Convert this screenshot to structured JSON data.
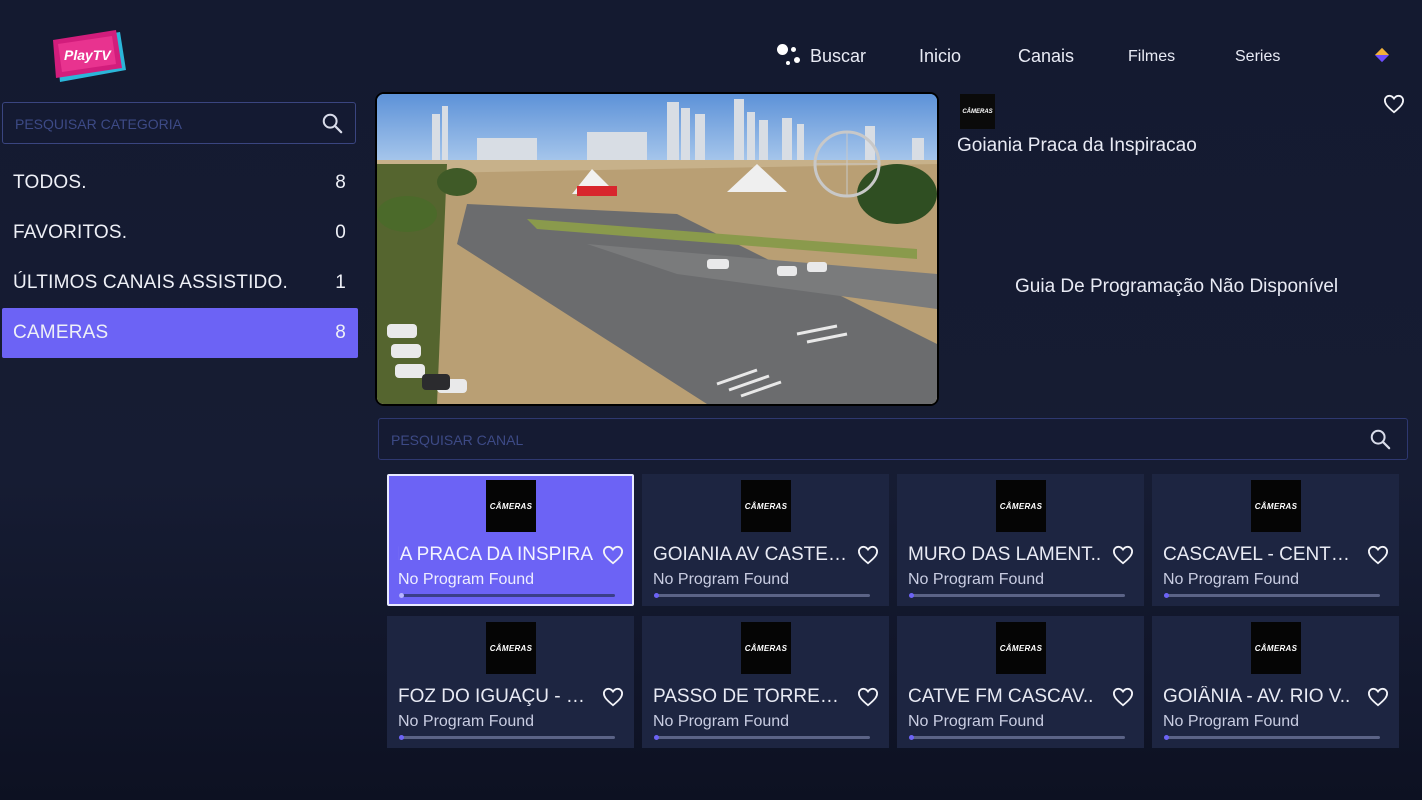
{
  "header": {
    "logo_text": "PlayTV",
    "nav": {
      "search": "Buscar",
      "home": "Inicio",
      "channels": "Canais",
      "movies": "Filmes",
      "series": "Series"
    }
  },
  "sidebar": {
    "search_placeholder": "PESQUISAR CATEGORIA",
    "categories": [
      {
        "label": "TODOS.",
        "count": "8",
        "active": false
      },
      {
        "label": "FAVORITOS.",
        "count": "0",
        "active": false
      },
      {
        "label": "ÚLTIMOS CANAIS ASSISTIDO.",
        "count": "1",
        "active": false
      },
      {
        "label": "CAMERAS",
        "count": "8",
        "active": true
      }
    ]
  },
  "player": {
    "channel_logo_text": "CÂMERAS",
    "channel_name": "Goiania Praca da Inspiracao",
    "epg_message": "Guia De Programação Não Disponível"
  },
  "channel_search": {
    "placeholder": "PESQUISAR CANAL"
  },
  "channels": [
    {
      "title": "IA PRACA DA INSPIRA",
      "program": "No Program Found",
      "logo": "CÂMERAS",
      "progress": 0.02,
      "selected": true
    },
    {
      "title": "GOIANIA AV CASTEL..",
      "program": "No Program Found",
      "logo": "CÂMERAS",
      "progress": 0.02,
      "selected": false
    },
    {
      "title": "MURO DAS LAMENT..",
      "program": "No Program Found",
      "logo": "CÂMERAS",
      "progress": 0.02,
      "selected": false
    },
    {
      "title": "CASCAVEL - CENTRO",
      "program": "No Program Found",
      "logo": "CÂMERAS",
      "progress": 0.02,
      "selected": false
    },
    {
      "title": "FOZ DO IGUAÇU - PA..",
      "program": "No Program Found",
      "logo": "CÂMERAS",
      "progress": 0.02,
      "selected": false
    },
    {
      "title": "PASSO DE TORRES -..",
      "program": "No Program Found",
      "logo": "CÂMERAS",
      "progress": 0.02,
      "selected": false
    },
    {
      "title": "CATVE FM CASCAV..",
      "program": "No Program Found",
      "logo": "CÂMERAS",
      "progress": 0.02,
      "selected": false
    },
    {
      "title": "GOIÂNIA - AV. RIO V..",
      "program": "No Program Found",
      "logo": "CÂMERAS",
      "progress": 0.02,
      "selected": false
    }
  ],
  "colors": {
    "accent": "#6c63f5",
    "background": "#151b32",
    "card": "#1d2541"
  }
}
